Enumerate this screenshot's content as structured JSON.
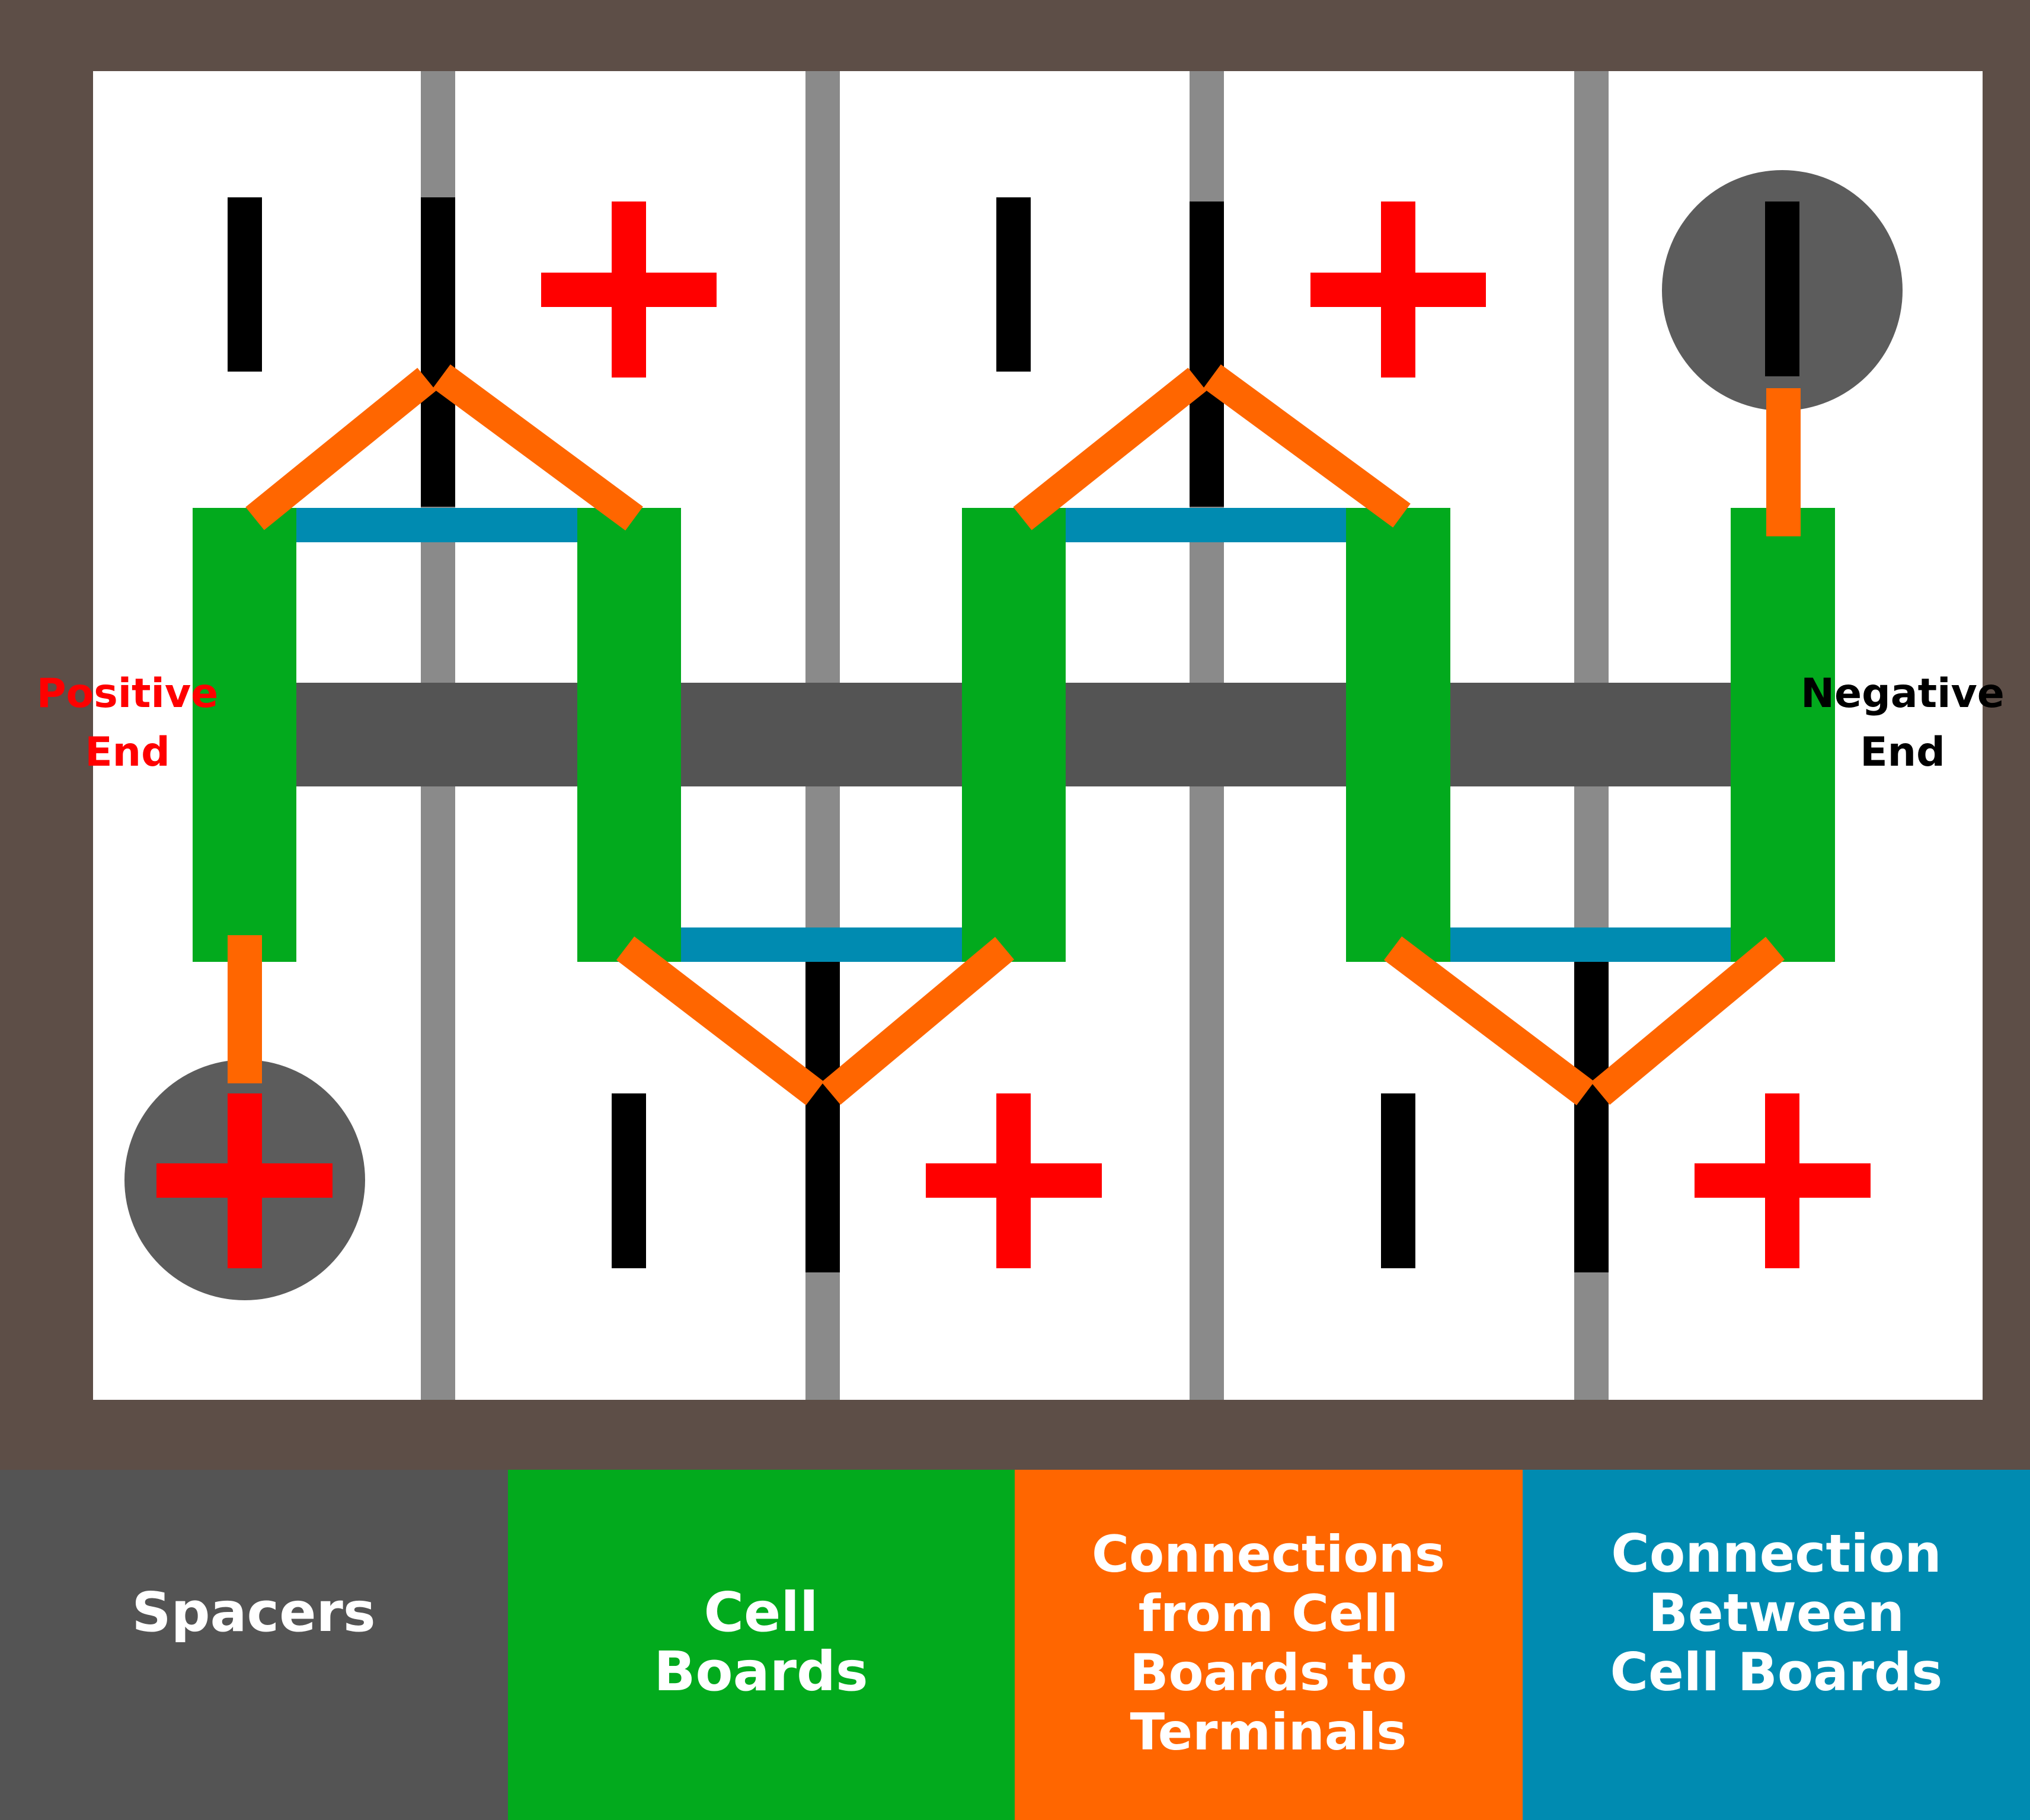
{
  "colors": {
    "frame": "#5d4e47",
    "background": "#ffffff",
    "cell_divider": "#8a8a8a",
    "spacer": "#545454",
    "cell_board": "#02aa1d",
    "terminal_connection": "#ff6600",
    "board_connection": "#008bb1",
    "terminal_tab": "#000000",
    "plus": "#ff0000",
    "pack_terminal": "#5c5c5c"
  },
  "labels": {
    "positive_end": [
      "Positive",
      "End"
    ],
    "negative_end": [
      "Negative",
      "End"
    ]
  },
  "legend": [
    {
      "lines": [
        "Spacers"
      ],
      "color": "#545454"
    },
    {
      "lines": [
        "Cell",
        "Boards"
      ],
      "color": "#02aa1d"
    },
    {
      "lines": [
        "Connections",
        "from Cell",
        "Boards to",
        "Terminals"
      ],
      "color": "#ff6600"
    },
    {
      "lines": [
        "Connection",
        "Between",
        "Cell Boards"
      ],
      "color": "#008bb1"
    }
  ],
  "cells": [
    {
      "top": "minus",
      "bottom": "plus"
    },
    {
      "top": "plus",
      "bottom": "minus"
    },
    {
      "top": "minus",
      "bottom": "plus"
    },
    {
      "top": "plus",
      "bottom": "minus"
    },
    {
      "top": "minus",
      "bottom": "plus"
    }
  ]
}
